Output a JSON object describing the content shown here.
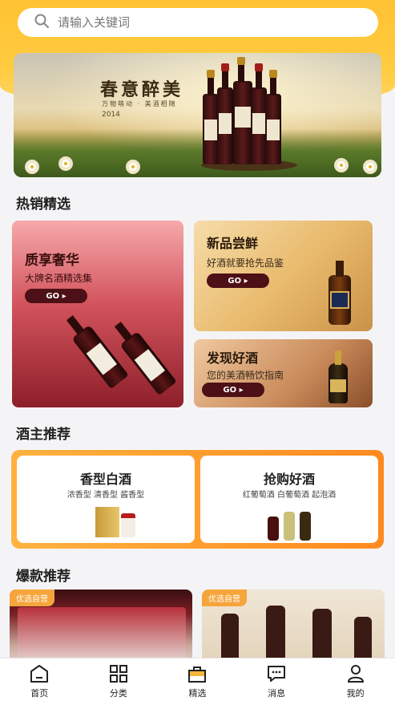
{
  "search": {
    "placeholder": "请输入关键词",
    "icon": "search-icon"
  },
  "banner": {
    "title": "春意醉美",
    "subtitle": "万物萌动 · 美酒相随",
    "year": "2014"
  },
  "sections": {
    "hot_picks": "热销精选",
    "owner_recs": "酒主推荐",
    "hot_items": "爆款推荐"
  },
  "hot_picks": {
    "luxury": {
      "title": "质享奢华",
      "desc": "大牌名酒精选集",
      "go": "GO ▸"
    },
    "new": {
      "title": "新品尝鲜",
      "desc": "好酒就要抢先品鉴",
      "go": "GO ▸"
    },
    "discover": {
      "title": "发现好酒",
      "desc": "您的美酒畅饮指南",
      "go": "GO ▸"
    }
  },
  "owner_recs": [
    {
      "title": "香型白酒",
      "desc": "浓香型 清香型 酱香型"
    },
    {
      "title": "抢购好酒",
      "desc": "红葡萄酒 白葡萄酒 起泡酒"
    }
  ],
  "hot_items": [
    {
      "tag": "优选自营"
    },
    {
      "tag": "优选自营"
    }
  ],
  "tabbar": [
    {
      "label": "首页",
      "icon": "home-icon"
    },
    {
      "label": "分类",
      "icon": "grid-icon"
    },
    {
      "label": "精选",
      "icon": "bag-icon"
    },
    {
      "label": "消息",
      "icon": "message-icon"
    },
    {
      "label": "我的",
      "icon": "user-icon"
    }
  ],
  "colors": {
    "accent": "#ffc233",
    "go_button": "#4c1016",
    "tag": "#f5a53b"
  }
}
